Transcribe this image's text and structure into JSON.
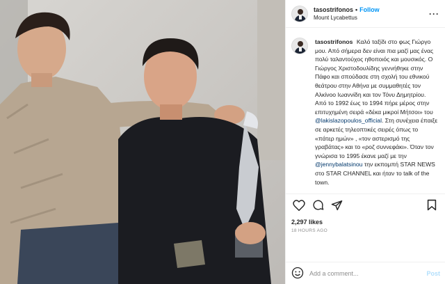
{
  "post": {
    "username": "tasostrifonos",
    "follow_label": "Follow",
    "location": "Mount Lycabettus",
    "more_icon": "more-options-icon"
  },
  "caption": {
    "username": "tasostrifonos",
    "text_1": "Καλό ταξίδι στο φως Γιώργο μου. Από σήμερα δεν είναι πια μαζί μας ένας πολύ ταλαντούχος ηθοποιός και μουσικός. Ο Γιώργος Χριστοδουλίδης γεννήθηκε στην Πάφο και σπούδασε στη σχολή του εθνικού θεάτρου στην Αθήνα με συμμαθητές τον Αλκίνοο Ιωαννίδη και τον Τόνυ Δημητρίου. Από το 1992 έως το 1994 πήρε μέρος στην επιτυχημένη σειρά «δέκα μικροί Μήτσοι» του",
    "mention_1": "@lakislazopoulos_official",
    "text_2": ". Στη συνέχεια έπαιξε σε αρκετές τηλεοπτικές σειρές όπως το «πάτερ ημών» , «τον αστερισμό της γραβάτας» και το «ροζ συννεφάκι». Όταν τον γνώρισα το 1995 έκανε μαζί με την",
    "mention_2": "@jennybalatsinou",
    "text_3": "την εκπομπή STAR NEWS στο STAR CHANNEL και ήταν το talk of the town."
  },
  "actions": {
    "like_icon": "heart-icon",
    "comment_icon": "comment-icon",
    "share_icon": "share-icon",
    "save_icon": "bookmark-icon"
  },
  "likes": "2,297 likes",
  "time_ago": "18 HOURS AGO",
  "comment_box": {
    "emoji_icon": "smiley-icon",
    "placeholder": "Add a comment...",
    "post_label": "Post"
  },
  "colors": {
    "accent": "#0095f6",
    "post_disabled": "#b2dffc",
    "mention": "#00376b",
    "muted": "#8e8e8e"
  }
}
